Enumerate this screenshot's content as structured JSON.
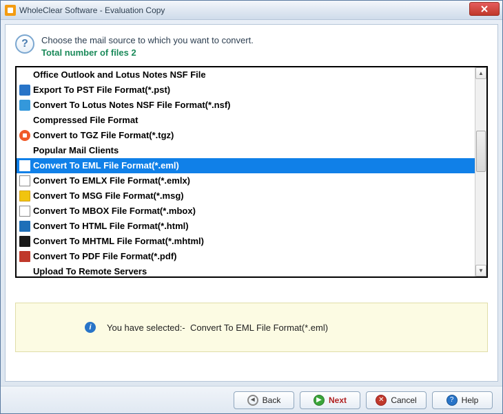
{
  "window": {
    "title": "WholeClear Software - Evaluation Copy"
  },
  "header": {
    "instruction": "Choose the mail source to which you want to convert.",
    "total_label": "Total number of files",
    "file_count": "2"
  },
  "categories": [
    {
      "type": "header",
      "label": "Office Outlook and Lotus Notes NSF File"
    },
    {
      "type": "item",
      "icon": "pst",
      "label": "Export To PST File Format(*.pst)",
      "selected": false
    },
    {
      "type": "item",
      "icon": "nsf",
      "label": "Convert To Lotus Notes NSF File Format(*.nsf)",
      "selected": false
    },
    {
      "type": "header",
      "label": "Compressed File Format"
    },
    {
      "type": "item",
      "icon": "tgz",
      "label": "Convert to TGZ File Format(*.tgz)",
      "selected": false
    },
    {
      "type": "header",
      "label": "Popular Mail Clients"
    },
    {
      "type": "item",
      "icon": "eml",
      "label": "Convert To EML File Format(*.eml)",
      "selected": true
    },
    {
      "type": "item",
      "icon": "emlx",
      "label": "Convert To EMLX File Format(*.emlx)",
      "selected": false
    },
    {
      "type": "item",
      "icon": "msg",
      "label": "Convert To MSG File Format(*.msg)",
      "selected": false
    },
    {
      "type": "item",
      "icon": "mbox",
      "label": "Convert To MBOX File Format(*.mbox)",
      "selected": false
    },
    {
      "type": "item",
      "icon": "html",
      "label": "Convert To HTML File Format(*.html)",
      "selected": false
    },
    {
      "type": "item",
      "icon": "mhtml",
      "label": "Convert To MHTML File Format(*.mhtml)",
      "selected": false
    },
    {
      "type": "item",
      "icon": "pdf",
      "label": "Convert To PDF File Format(*.pdf)",
      "selected": false
    },
    {
      "type": "header",
      "label": "Upload To Remote Servers"
    }
  ],
  "status": {
    "prefix": "You have selected:-",
    "selection": "Convert To EML File Format(*.eml)"
  },
  "buttons": {
    "back": "Back",
    "next": "Next",
    "cancel": "Cancel",
    "help": "Help"
  }
}
